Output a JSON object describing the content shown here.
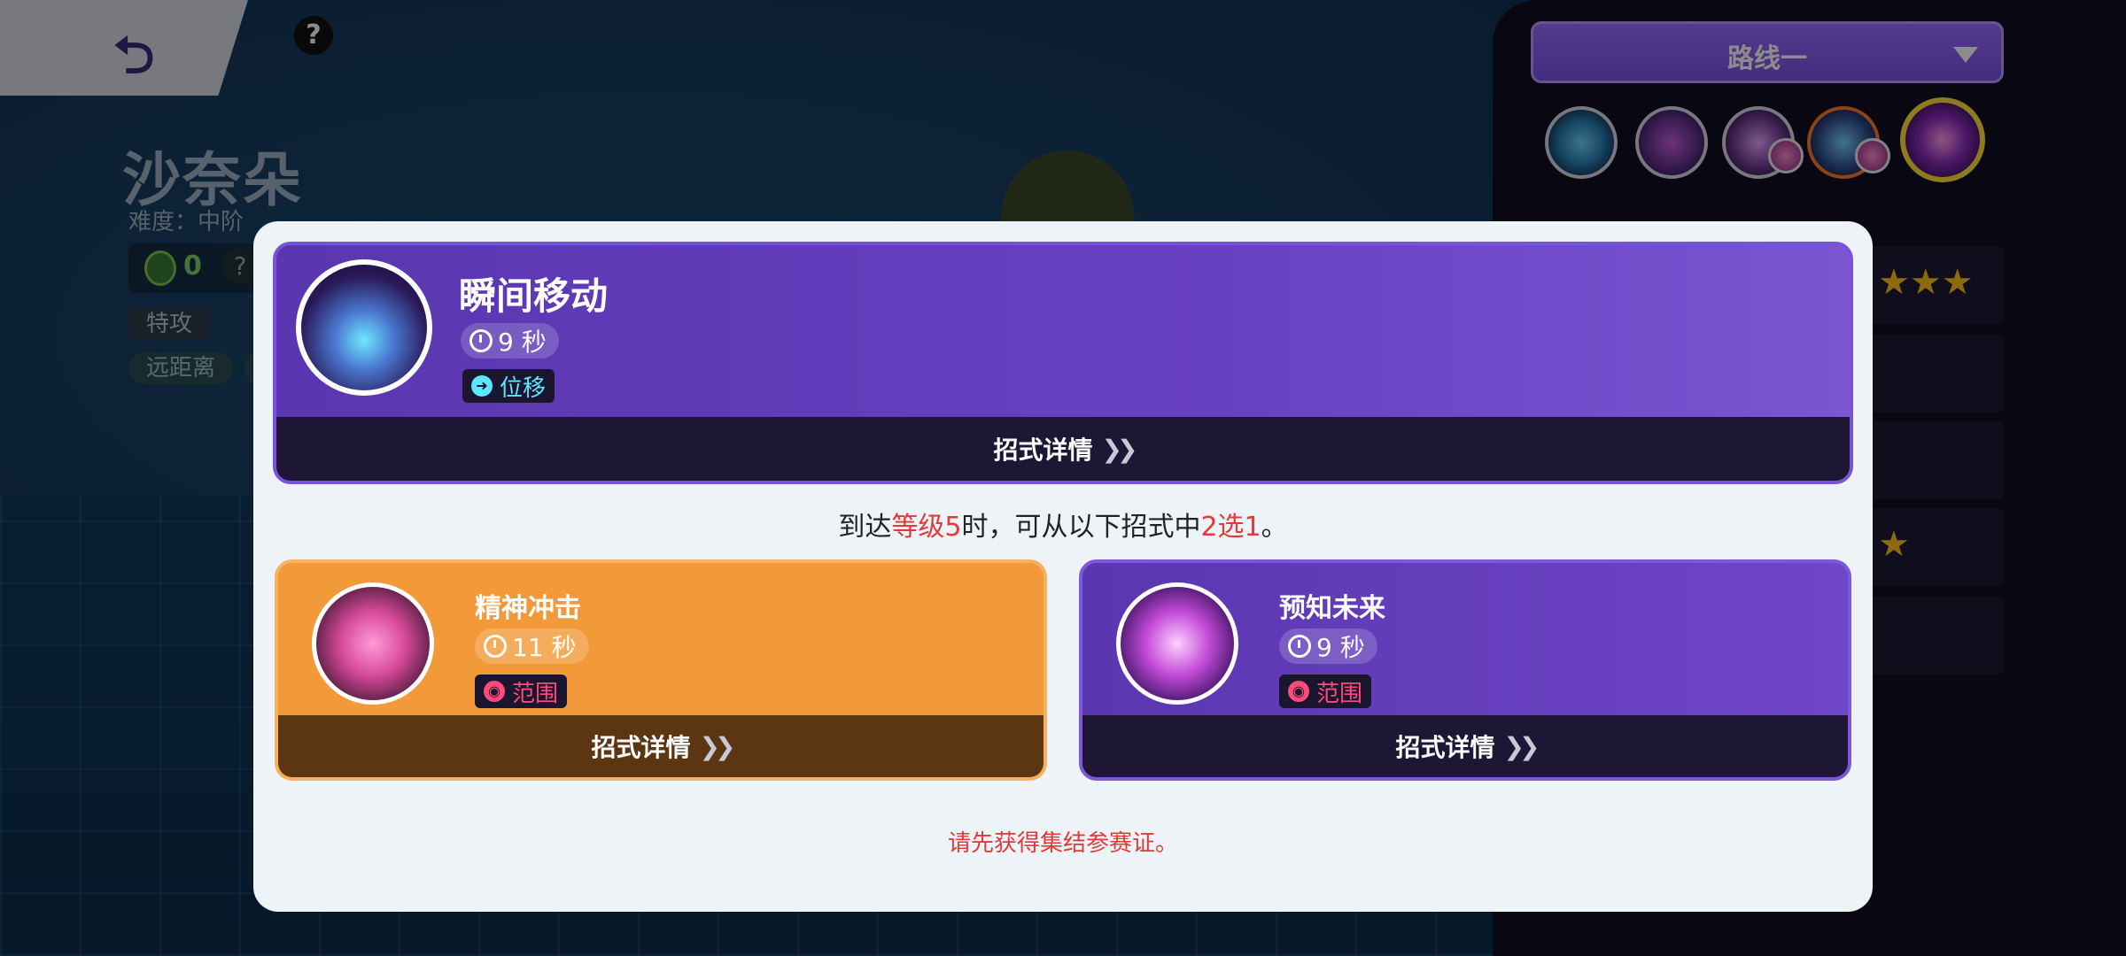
{
  "top": {
    "help": "?"
  },
  "pokemon": {
    "name": "沙奈朵",
    "difficulty": "难度：中阶",
    "medal_count": "0",
    "help": "?",
    "tag_attack": "特攻",
    "tag_range": "远距离"
  },
  "route": {
    "label": "路线一"
  },
  "skill_main": {
    "name": "瞬间移动",
    "cooldown": "9 秒",
    "type": "位移",
    "detail": "招式详情"
  },
  "choice_hint": {
    "prefix": "到达",
    "level": "等级5",
    "middle": "时，可从以下招式中",
    "count": "2选1",
    "suffix": "。"
  },
  "options": [
    {
      "name": "精神冲击",
      "cooldown": "11 秒",
      "type": "范围",
      "detail": "招式详情"
    },
    {
      "name": "预知未来",
      "cooldown": "9 秒",
      "type": "范围",
      "detail": "招式详情"
    }
  ],
  "warning": "请先获得集结参赛证。",
  "colors": {
    "accent_purple": "#6841c1",
    "accent_orange": "#f29a3a",
    "warn_red": "#e23a3a",
    "highlight_yellow": "#ffe03a"
  }
}
